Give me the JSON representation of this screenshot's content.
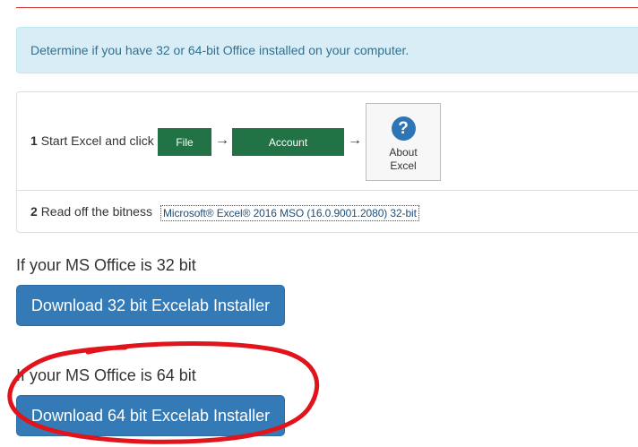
{
  "alert": {
    "text": "Determine if you have 32 or 64-bit Office installed on your computer."
  },
  "steps": {
    "step1": {
      "number": "1",
      "text": "Start Excel and click",
      "file_button": "File",
      "arrow1": "→",
      "account_button": "Account",
      "arrow2": "→",
      "about_tile": {
        "icon": "help-question-icon",
        "label_line1": "About",
        "label_line2": "Excel"
      }
    },
    "step2": {
      "number": "2",
      "text": "Read off the bitness",
      "version_string": "Microsoft® Excel® 2016 MSO (16.0.9001.2080) 32-bit"
    }
  },
  "downloads": [
    {
      "heading": "If your MS Office is 32 bit",
      "button": "Download 32 bit Excelab Installer"
    },
    {
      "heading": "If your MS Office is 64 bit",
      "button": "Download 64 bit Excelab Installer"
    }
  ],
  "colors": {
    "excel_green": "#217346",
    "primary_blue": "#337ab7",
    "info_bg": "#d9edf7",
    "annotation_red": "#e2141b"
  }
}
